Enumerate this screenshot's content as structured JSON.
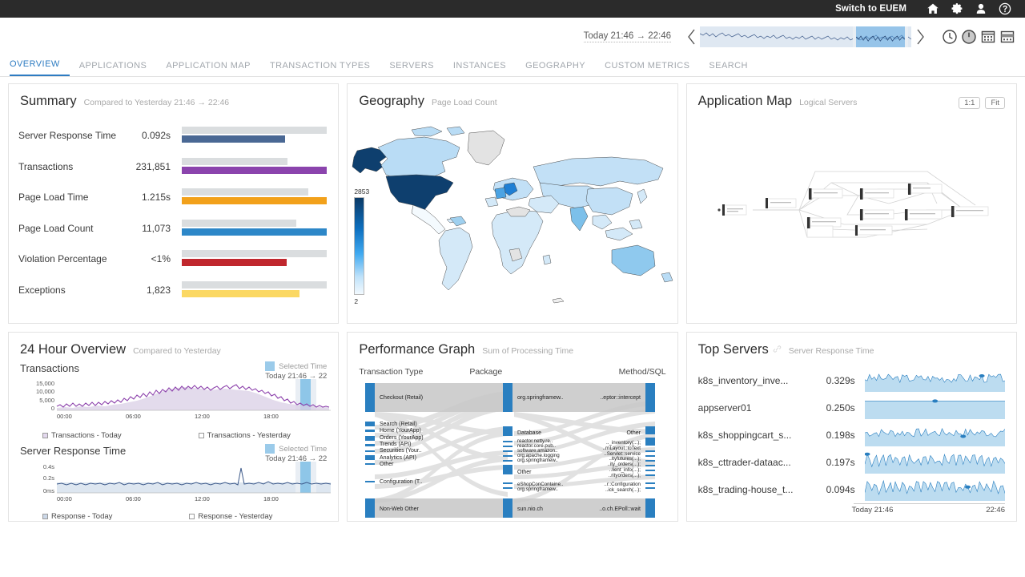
{
  "topbar": {
    "title": "Switch to EUEM",
    "icons": [
      {
        "name": "home-icon",
        "glyph": "home"
      },
      {
        "name": "gear-icon",
        "glyph": "gear"
      },
      {
        "name": "user-icon",
        "glyph": "user"
      },
      {
        "name": "help-icon",
        "glyph": "help"
      }
    ]
  },
  "timebar": {
    "range_label": "Today 21:46 → 22:46",
    "prev_label": "‹",
    "next_label": "›",
    "icons": [
      {
        "name": "clock-icon"
      },
      {
        "name": "clock-filled-icon"
      },
      {
        "name": "calendar-icon"
      },
      {
        "name": "calendar-range-icon"
      }
    ]
  },
  "tabs": [
    {
      "label": "OVERVIEW",
      "active": true
    },
    {
      "label": "APPLICATIONS",
      "active": false
    },
    {
      "label": "APPLICATION MAP",
      "active": false
    },
    {
      "label": "TRANSACTION TYPES",
      "active": false
    },
    {
      "label": "SERVERS",
      "active": false
    },
    {
      "label": "INSTANCES",
      "active": false
    },
    {
      "label": "GEOGRAPHY",
      "active": false
    },
    {
      "label": "CUSTOM METRICS",
      "active": false
    },
    {
      "label": "SEARCH",
      "active": false
    }
  ],
  "summary": {
    "title": "Summary",
    "subtitle": "Compared to Yesterday 21:46 → 22:46",
    "rows": [
      {
        "label": "Server Response Time",
        "value": "0.092s",
        "color": "#4a6894",
        "today_pct": 71,
        "yesterday_pct": 100
      },
      {
        "label": "Transactions",
        "value": "231,851",
        "color": "#8b44ad",
        "today_pct": 100,
        "yesterday_pct": 73
      },
      {
        "label": "Page Load Time",
        "value": "1.215s",
        "color": "#f2a11b",
        "today_pct": 100,
        "yesterday_pct": 87
      },
      {
        "label": "Page Load Count",
        "value": "11,073",
        "color": "#2d87c8",
        "today_pct": 100,
        "yesterday_pct": 79
      },
      {
        "label": "Violation Percentage",
        "value": "<1%",
        "color": "#c0272d",
        "today_pct": 72,
        "yesterday_pct": 100
      },
      {
        "label": "Exceptions",
        "value": "1,823",
        "color": "#fbd863",
        "today_pct": 81,
        "yesterday_pct": 100
      }
    ]
  },
  "geography": {
    "title": "Geography",
    "subtitle": "Page Load Count",
    "legend_max": "2853",
    "legend_min": "2"
  },
  "appmap": {
    "title": "Application Map",
    "subtitle": "Logical Servers",
    "zoom_1_1": "1:1",
    "zoom_fit": "Fit"
  },
  "overview24": {
    "title": "24 Hour Overview",
    "subtitle": "Compared to Yesterday",
    "charts": [
      {
        "name": "Transactions",
        "selected_label": "Selected Time",
        "selected_range": "Today 21:46 → 22",
        "y_ticks": [
          "15,000",
          "10,000",
          "5,000",
          "0"
        ],
        "x_ticks": [
          "00:00",
          "06:00",
          "12:00",
          "18:00"
        ],
        "legend": [
          "Transactions - Today",
          "Transactions - Yesterday"
        ],
        "color_today": "#8e44ad"
      },
      {
        "name": "Server Response Time",
        "selected_label": "Selected Time",
        "selected_range": "Today 21:46 → 22",
        "y_ticks": [
          "0.4s",
          "0.2s",
          "0ms"
        ],
        "x_ticks": [
          "00:00",
          "06:00",
          "12:00",
          "18:00"
        ],
        "legend": [
          "Response - Today",
          "Response - Yesterday"
        ],
        "color_today": "#3d5a8a"
      }
    ]
  },
  "perfgraph": {
    "title": "Performance Graph",
    "subtitle": "Sum of Processing Time",
    "columns": [
      "Transaction Type",
      "Package",
      "Method/SQL"
    ],
    "transaction_types": [
      "Checkout (Retail)",
      "Search (Retail)",
      "Home (YourApp)",
      "Orders (YourApp)",
      "Trends (API)",
      "Securities (Your..",
      "Analytics (API)",
      "Other",
      "Configuration (T..",
      "Non-Web Other"
    ],
    "packages": [
      "org.springframew..",
      "Database",
      "reactor.netty.re..",
      "reactor.core.pub..",
      "software.amazon..",
      "org.apache.logging",
      "org.springframew..",
      "Other",
      "eShopConContaine..",
      "org.springframew..",
      "sun.nio.ch"
    ],
    "methods": [
      "..eptor::intercept",
      "Other",
      ".._inventory(...);",
      "..rnLayout::toText",
      "..Servlet::service",
      "..ltyfutures(...);",
      "..ity_orders(...);",
      "..lient_info(...);",
      "..rityorders(...);",
      "..r::Configuration",
      "..ick_search(...);",
      "..o.ch.EPoll::wait"
    ]
  },
  "topservers": {
    "title": "Top Servers",
    "subtitle": "Server Response Time",
    "axis_start": "Today 21:46",
    "axis_end": "22:46",
    "rows": [
      {
        "name": "k8s_inventory_inve...",
        "value": "0.329s"
      },
      {
        "name": "appserver01",
        "value": "0.250s"
      },
      {
        "name": "k8s_shoppingcart_s...",
        "value": "0.198s"
      },
      {
        "name": "k8s_cttrader-dataac...",
        "value": "0.197s"
      },
      {
        "name": "k8s_trading-house_t...",
        "value": "0.094s"
      }
    ]
  },
  "chart_data": {
    "type": "bar",
    "title": "Summary",
    "categories": [
      "Server Response Time",
      "Transactions",
      "Page Load Time",
      "Page Load Count",
      "Violation Percentage",
      "Exceptions"
    ],
    "series": [
      {
        "name": "Today",
        "values": [
          71,
          100,
          100,
          100,
          72,
          81
        ]
      },
      {
        "name": "Yesterday",
        "values": [
          100,
          73,
          87,
          79,
          100,
          100
        ]
      }
    ],
    "display_values": [
      "0.092s",
      "231,851",
      "1.215s",
      "11,073",
      "<1%",
      "1,823"
    ],
    "xlabel": "",
    "ylabel": "",
    "grid": false,
    "legend": "none"
  }
}
